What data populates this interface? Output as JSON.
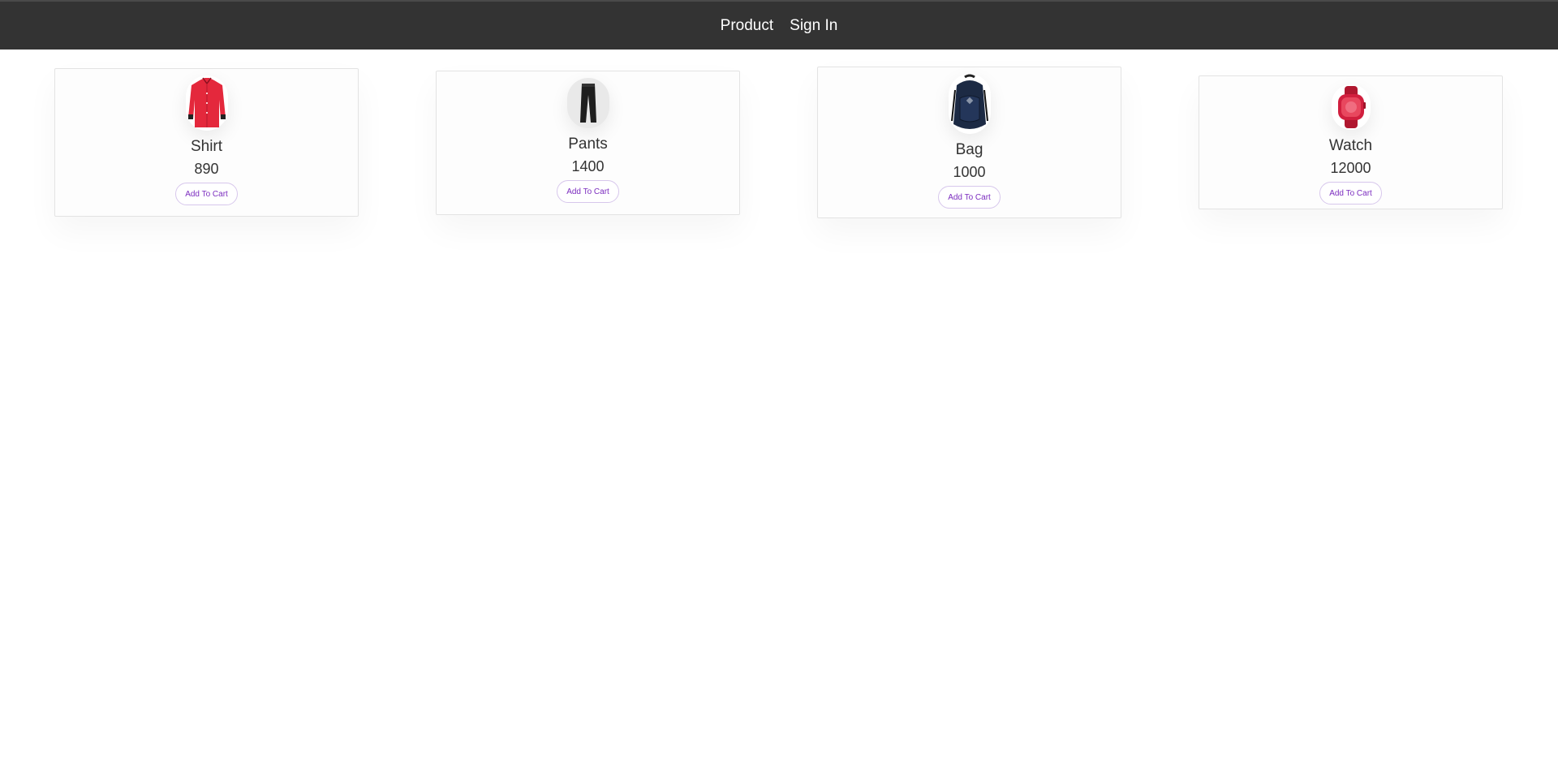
{
  "nav": {
    "links": [
      "Product",
      "Sign In"
    ]
  },
  "products": [
    {
      "name": "Shirt",
      "price": "890",
      "button": "Add To Cart",
      "icon": "shirt-icon",
      "color": "#e4283c"
    },
    {
      "name": "Pants",
      "price": "1400",
      "button": "Add To Cart",
      "icon": "pants-icon",
      "color": "#1f1f1f"
    },
    {
      "name": "Bag",
      "price": "1000",
      "button": "Add To Cart",
      "icon": "backpack-icon",
      "color": "#1c2a44"
    },
    {
      "name": "Watch",
      "price": "12000",
      "button": "Add To Cart",
      "icon": "smartwatch-icon",
      "color": "#d11f3e"
    }
  ],
  "colors": {
    "navbar": "#333333",
    "button_text": "#7b2cbf"
  }
}
